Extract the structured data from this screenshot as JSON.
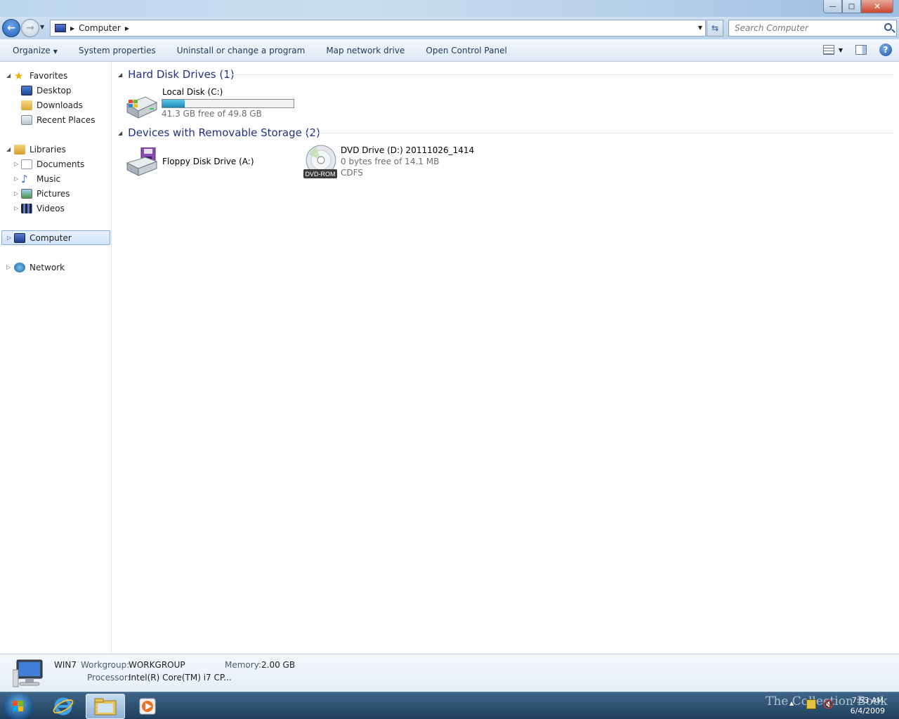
{
  "window": {
    "controls": {
      "minimize": "—",
      "maximize": "□",
      "close": "✕"
    }
  },
  "address": {
    "segments": [
      "Computer"
    ],
    "refresh_icon": "refresh-icon",
    "search_placeholder": "Search Computer"
  },
  "toolbar": {
    "organize": "Organize",
    "system_properties": "System properties",
    "uninstall": "Uninstall or change a program",
    "map_drive": "Map network drive",
    "control_panel": "Open Control Panel"
  },
  "nav": {
    "favorites": "Favorites",
    "desktop": "Desktop",
    "downloads": "Downloads",
    "recent": "Recent Places",
    "libraries": "Libraries",
    "documents": "Documents",
    "music": "Music",
    "pictures": "Pictures",
    "videos": "Videos",
    "computer": "Computer",
    "network": "Network"
  },
  "content": {
    "hdd_group": "Hard Disk Drives (1)",
    "removable_group": "Devices with Removable Storage (2)",
    "local_disk": {
      "name": "Local Disk (C:)",
      "free": "41.3 GB free of 49.8 GB",
      "used_fraction": 0.17
    },
    "floppy": {
      "name": "Floppy Disk Drive (A:)"
    },
    "dvd": {
      "name": "DVD Drive (D:) 20111026_1414",
      "free": "0 bytes free of 14.1 MB",
      "fs": "CDFS",
      "badge": "DVD-ROM"
    }
  },
  "details": {
    "name": "WIN7",
    "workgroup_label": "Workgroup:",
    "workgroup": "WORKGROUP",
    "memory_label": "Memory:",
    "memory": "2.00 GB",
    "processor_label": "Processor:",
    "processor": "Intel(R) Core(TM) i7 CP..."
  },
  "taskbar": {
    "time": "7:53 AM",
    "date": "6/4/2009",
    "watermark": "The Collection Book"
  },
  "colors": {
    "accent": "#1e3287",
    "capacity_fill": "#26a0d0"
  }
}
